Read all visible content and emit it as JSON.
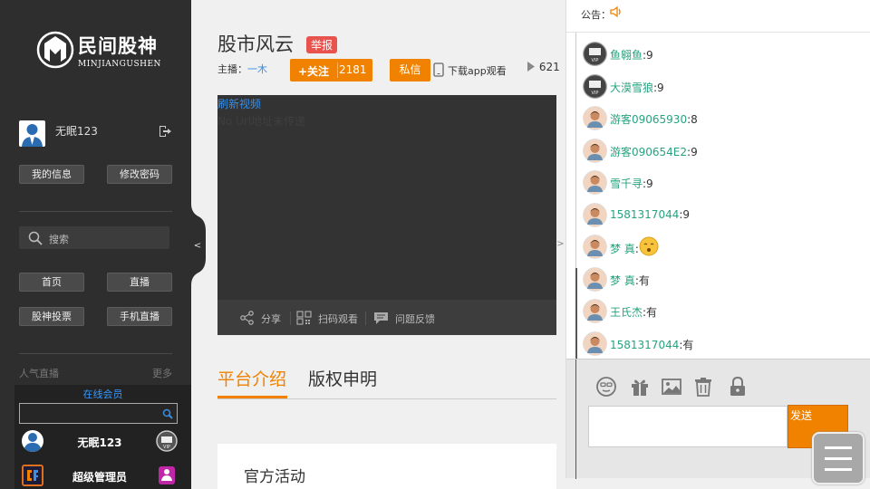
{
  "sidebar": {
    "logo": {
      "cn": "民间股神",
      "en": "MINJIANGUSHEN"
    },
    "user": {
      "name": "无眠123"
    },
    "buttons": {
      "my_info": "我的信息",
      "change_password": "修改密码",
      "home": "首页",
      "live": "直播",
      "vote": "股神投票",
      "mobile_live": "手机直播"
    },
    "search_placeholder": "搜索",
    "popular": {
      "title": "人气直播",
      "more": "更多"
    },
    "online_members": {
      "title": "在线会员",
      "items": [
        {
          "name": "无眠123"
        },
        {
          "name": "超级管理员"
        }
      ]
    },
    "collapse_arrow": "<"
  },
  "main": {
    "room_title": "股市风云",
    "report": "举报",
    "host_label": "主播：",
    "host_name": "一木",
    "follow_label": "+关注",
    "follow_count": "2181",
    "private_message": "私信",
    "download_app": "下载app观看",
    "viewers": "621",
    "video": {
      "refresh": "刷新视频",
      "no_url": "No Url地址未传递"
    },
    "video_bar": {
      "share": "分享",
      "scan": "扫码观看",
      "feedback": "问题反馈"
    },
    "tabs": [
      {
        "label": "平台介绍",
        "active": true
      },
      {
        "label": "版权申明",
        "active": false
      }
    ],
    "content_heading": "官方活动",
    "handle_arrow": ">"
  },
  "chat": {
    "notice_label": "公告：",
    "messages": [
      {
        "name": "鱼翱鱼",
        "text": ":9",
        "avatar": "vip"
      },
      {
        "name": "大漠雪狼",
        "text": ":9",
        "avatar": "vip"
      },
      {
        "name": "游客09065930",
        "text": ":8",
        "avatar": "guest"
      },
      {
        "name": "游客090654E2",
        "text": ":9",
        "avatar": "guest"
      },
      {
        "name": "雪千寻",
        "text": ":9",
        "avatar": "guest"
      },
      {
        "name": "1581317044",
        "text": ":9",
        "avatar": "guest"
      },
      {
        "name": "梦 真",
        "text": ":",
        "avatar": "guest",
        "emoji": true
      },
      {
        "name": "梦 真",
        "text": ":有",
        "avatar": "guest"
      },
      {
        "name": "王氏杰",
        "text": ":有",
        "avatar": "guest"
      },
      {
        "name": "1581317044",
        "text": ":有",
        "avatar": "guest"
      }
    ],
    "send": "发送"
  },
  "colors": {
    "accent": "#f08200",
    "sidebar_bg": "#2e2e2e",
    "chat_name": "#27a37f",
    "report_red": "#e8534e",
    "link_blue": "#3a8ee6"
  }
}
